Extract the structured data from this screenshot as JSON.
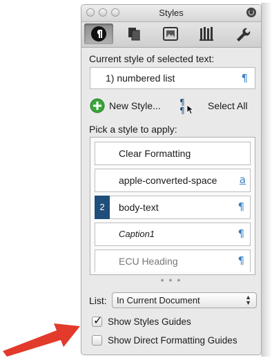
{
  "window": {
    "title": "Styles"
  },
  "toolbar": {
    "tabs": [
      {
        "icon": "paragraph-styles-icon",
        "active": true
      },
      {
        "icon": "copy-documents-icon",
        "active": false
      },
      {
        "icon": "image-frame-icon",
        "active": false
      },
      {
        "icon": "columns-icon",
        "active": false
      },
      {
        "icon": "wrench-icon",
        "active": false
      }
    ]
  },
  "current_style": {
    "label": "Current style of selected text:",
    "value": "1)  numbered list",
    "marker": "¶"
  },
  "actions": {
    "new_style": "New Style...",
    "select_all": "Select All"
  },
  "pick": {
    "label": "Pick a style to apply:",
    "items": [
      {
        "name": "Clear Formatting",
        "marker": "",
        "badge": ""
      },
      {
        "name": "apple-converted-space",
        "marker": "a",
        "badge": ""
      },
      {
        "name": "body-text",
        "marker": "¶",
        "badge": "2"
      },
      {
        "name": "Caption1",
        "marker": "¶",
        "badge": ""
      },
      {
        "name": "ECU Heading",
        "marker": "¶",
        "badge": ""
      }
    ]
  },
  "list": {
    "label": "List:",
    "selected": "In Current Document"
  },
  "options": {
    "show_styles_guides": {
      "label": "Show Styles Guides",
      "checked": true
    },
    "show_direct_formatting_guides": {
      "label": "Show Direct Formatting Guides",
      "checked": false
    }
  },
  "colors": {
    "accent_blue": "#3b82c4",
    "badge_navy": "#1f4e7a",
    "arrow_red": "#e23a2b"
  }
}
